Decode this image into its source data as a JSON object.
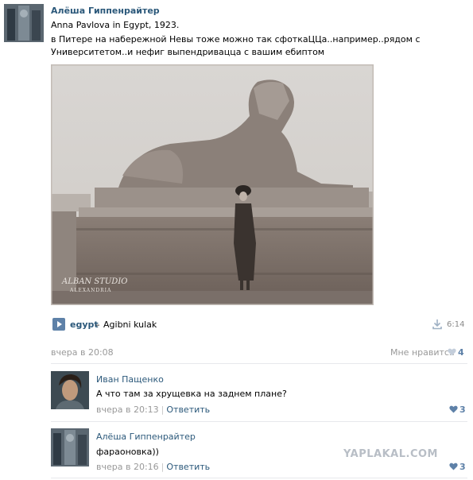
{
  "post": {
    "author": "Алёша Гиппенрайтер",
    "line1": "Anna Pavlova in Egypt, 1923.",
    "text": "в Питере на набережной Невы тоже можно так сфоткаЦЦа..например..рядом с Университетом..и нефиг выпендриваццa с вашим ебиптом",
    "photo_caption_line1": "ALBAN STUDIO",
    "photo_caption_line2": "ALEXANDRIA",
    "date": "вчера в 20:08",
    "like_label": "Мне нравится",
    "like_count": "4"
  },
  "audio": {
    "artist": "egypt",
    "separator": "–",
    "title": "Agibni kulak",
    "duration": "6:14"
  },
  "comments": [
    {
      "name": "Иван Пащенко",
      "text": "А что там за хрущевка на заднем плане?",
      "time": "вчера в 20:13",
      "separator": "|",
      "reply": "Ответить",
      "likes": "3"
    },
    {
      "name": "Алёша Гиппенрайтер",
      "text": "фараоновка))",
      "time": "вчера в 20:16",
      "separator": "|",
      "reply": "Ответить",
      "likes": "3"
    }
  ],
  "watermark": "YAPLAKAL.COM",
  "colors": {
    "link": "#2b587a",
    "muted": "#999999",
    "accent": "#5e81a8"
  },
  "icons": [
    "play-icon",
    "download-icon",
    "heart-icon"
  ]
}
